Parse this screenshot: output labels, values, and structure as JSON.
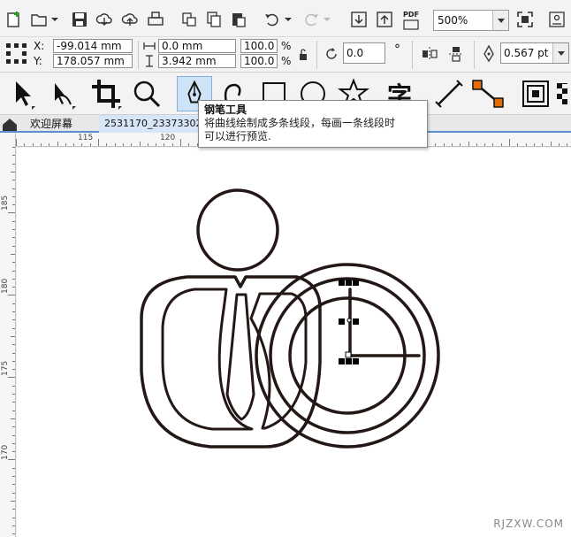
{
  "toolbar": {
    "zoom_value": "500%",
    "pdf_label": "PDF"
  },
  "property_bar": {
    "x_label": "X:",
    "y_label": "Y:",
    "x_value": "-99.014 mm",
    "y_value": "178.057 mm",
    "width_value": "0.0 mm",
    "height_value": "3.942 mm",
    "scale_x": "100.0",
    "scale_y": "100.0",
    "percent_symbol_1": "%",
    "percent_symbol_2": "%",
    "rotation_value": "0.0",
    "degree_symbol": "°",
    "outline_width": "0.567 pt"
  },
  "tabs": {
    "welcome": "欢迎屏幕",
    "document": "2531170_2337330233"
  },
  "ruler": {
    "h_115": "115",
    "h_120": "120",
    "v_185": "185",
    "v_180": "180",
    "v_175": "175",
    "v_170": "170"
  },
  "tooltip": {
    "title": "钢笔工具",
    "line1": "将曲线绘制成多条线段，每画一条线段时",
    "line2": "可以进行预览."
  },
  "watermark": "RJZXW.COM",
  "colors": {
    "active_tool_bg": "#cfe3f7",
    "tab_underline": "#5a8fd0",
    "drawing_stroke": "#231815",
    "accent_orange": "#e36c0a"
  }
}
